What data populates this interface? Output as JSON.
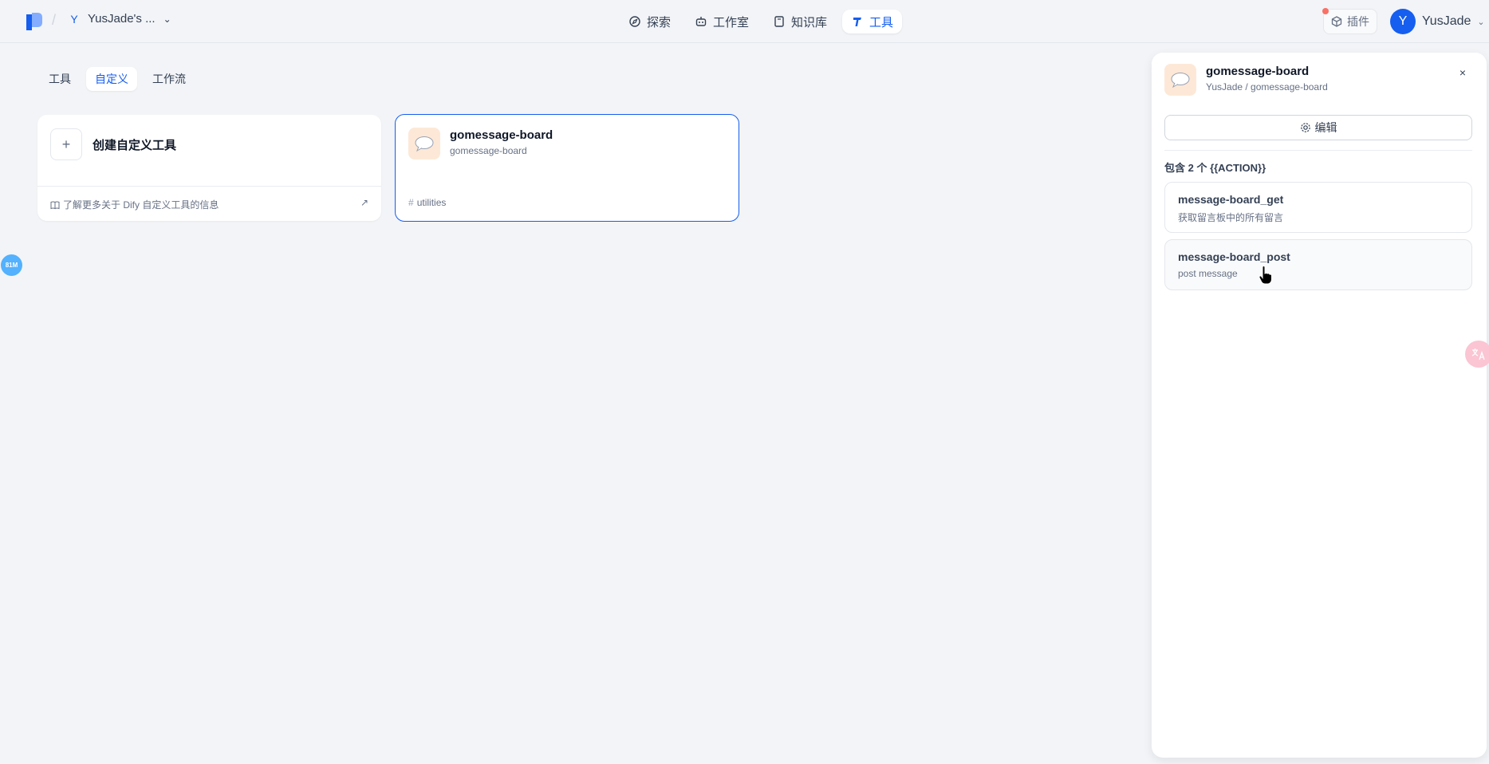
{
  "header": {
    "workspace_initial": "Y",
    "workspace_name": "YusJade's ...",
    "nav": [
      {
        "label": "探索",
        "icon": "compass-icon"
      },
      {
        "label": "工作室",
        "icon": "robot-icon"
      },
      {
        "label": "知识库",
        "icon": "book-icon"
      },
      {
        "label": "工具",
        "icon": "tool-icon",
        "active": true
      }
    ],
    "plugin_label": "插件",
    "user_initial": "Y",
    "user_name": "YusJade"
  },
  "tabs": [
    {
      "label": "工具"
    },
    {
      "label": "自定义",
      "active": true
    },
    {
      "label": "工作流"
    }
  ],
  "create_card": {
    "plus": "+",
    "title": "创建自定义工具",
    "learn_more": "了解更多关于 Dify 自定义工具的信息"
  },
  "tool_card": {
    "name": "gomessage-board",
    "subtitle": "gomessage-board",
    "tag_hash": "#",
    "tag": "utilities"
  },
  "memory_badge": "81M",
  "panel": {
    "title": "gomessage-board",
    "path": "YusJade / gomessage-board",
    "close": "×",
    "edit_label": "编辑",
    "contains_label": "包含 2 个 {{ACTION}}",
    "actions": [
      {
        "name": "message-board_get",
        "description": "获取留言板中的所有留言"
      },
      {
        "name": "message-board_post",
        "description": "post message"
      }
    ]
  },
  "colors": {
    "accent": "#155eef",
    "background": "#f2f4f7",
    "tool_icon_bg": "#fde8d7"
  }
}
